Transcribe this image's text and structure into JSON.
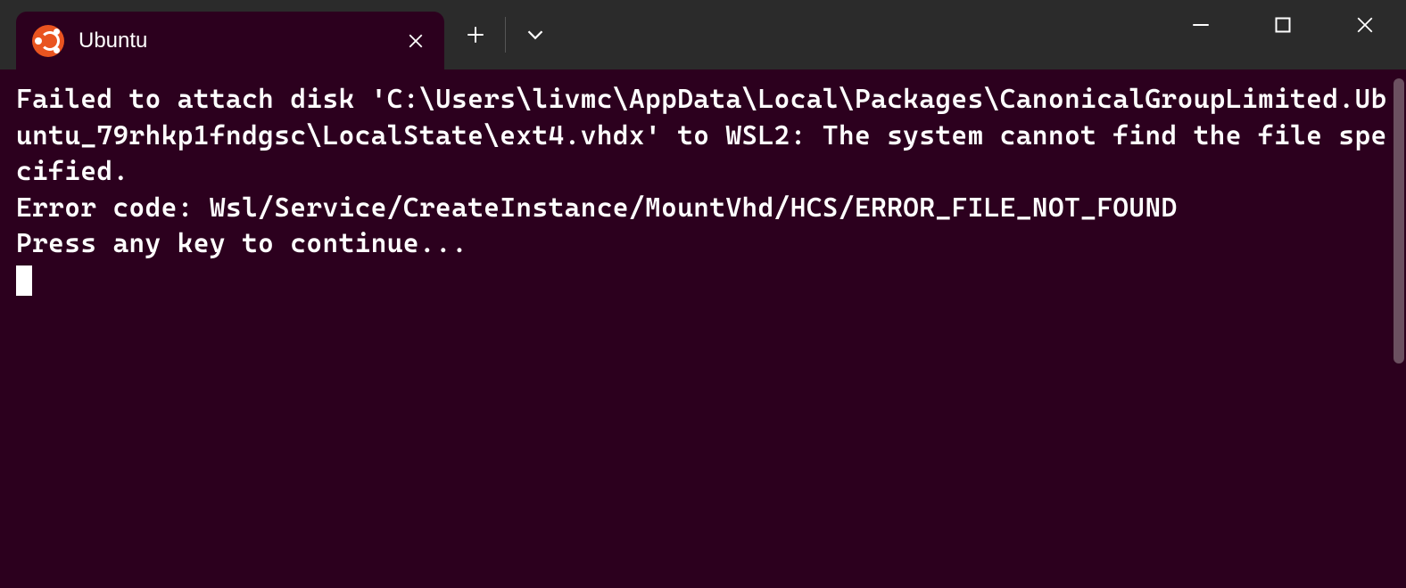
{
  "tab": {
    "title": "Ubuntu",
    "icon_name": "ubuntu-logo-icon"
  },
  "terminal": {
    "lines": [
      "Failed to attach disk 'C:\\Users\\livmc\\AppData\\Local\\Packages\\CanonicalGroupLimited.Ubuntu_79rhkp1fndgsc\\LocalState\\ext4.vhdx' to WSL2: The system cannot find the file specified.",
      "Error code: Wsl/Service/CreateInstance/MountVhd/HCS/ERROR_FILE_NOT_FOUND",
      "Press any key to continue..."
    ]
  },
  "colors": {
    "terminal_bg": "#2c001e",
    "titlebar_bg": "#2b2b2b",
    "text": "#ffffff",
    "ubuntu_orange": "#E95420"
  }
}
